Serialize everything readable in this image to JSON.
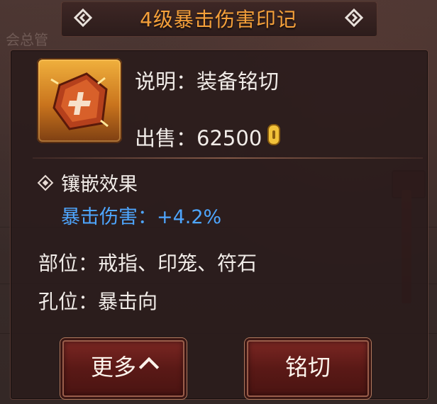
{
  "title": "4级暴击伤害印记",
  "item": {
    "description": "说明：装备铭切",
    "price_label": "出售：",
    "price_value": "62500",
    "icon": "rune-stone-icon"
  },
  "inlay": {
    "heading": "镶嵌效果",
    "effect": "暴击伤害：+4.2%"
  },
  "slots": {
    "position": "部位：戒指、印笼、符石",
    "socket": "孔位：暴击向"
  },
  "buttons": {
    "more": "更多",
    "inscribe": "铭切"
  },
  "background_text": "会总管",
  "colors": {
    "title": "#f5a03a",
    "effect": "#4ea6ff",
    "text": "#f1ece8"
  }
}
